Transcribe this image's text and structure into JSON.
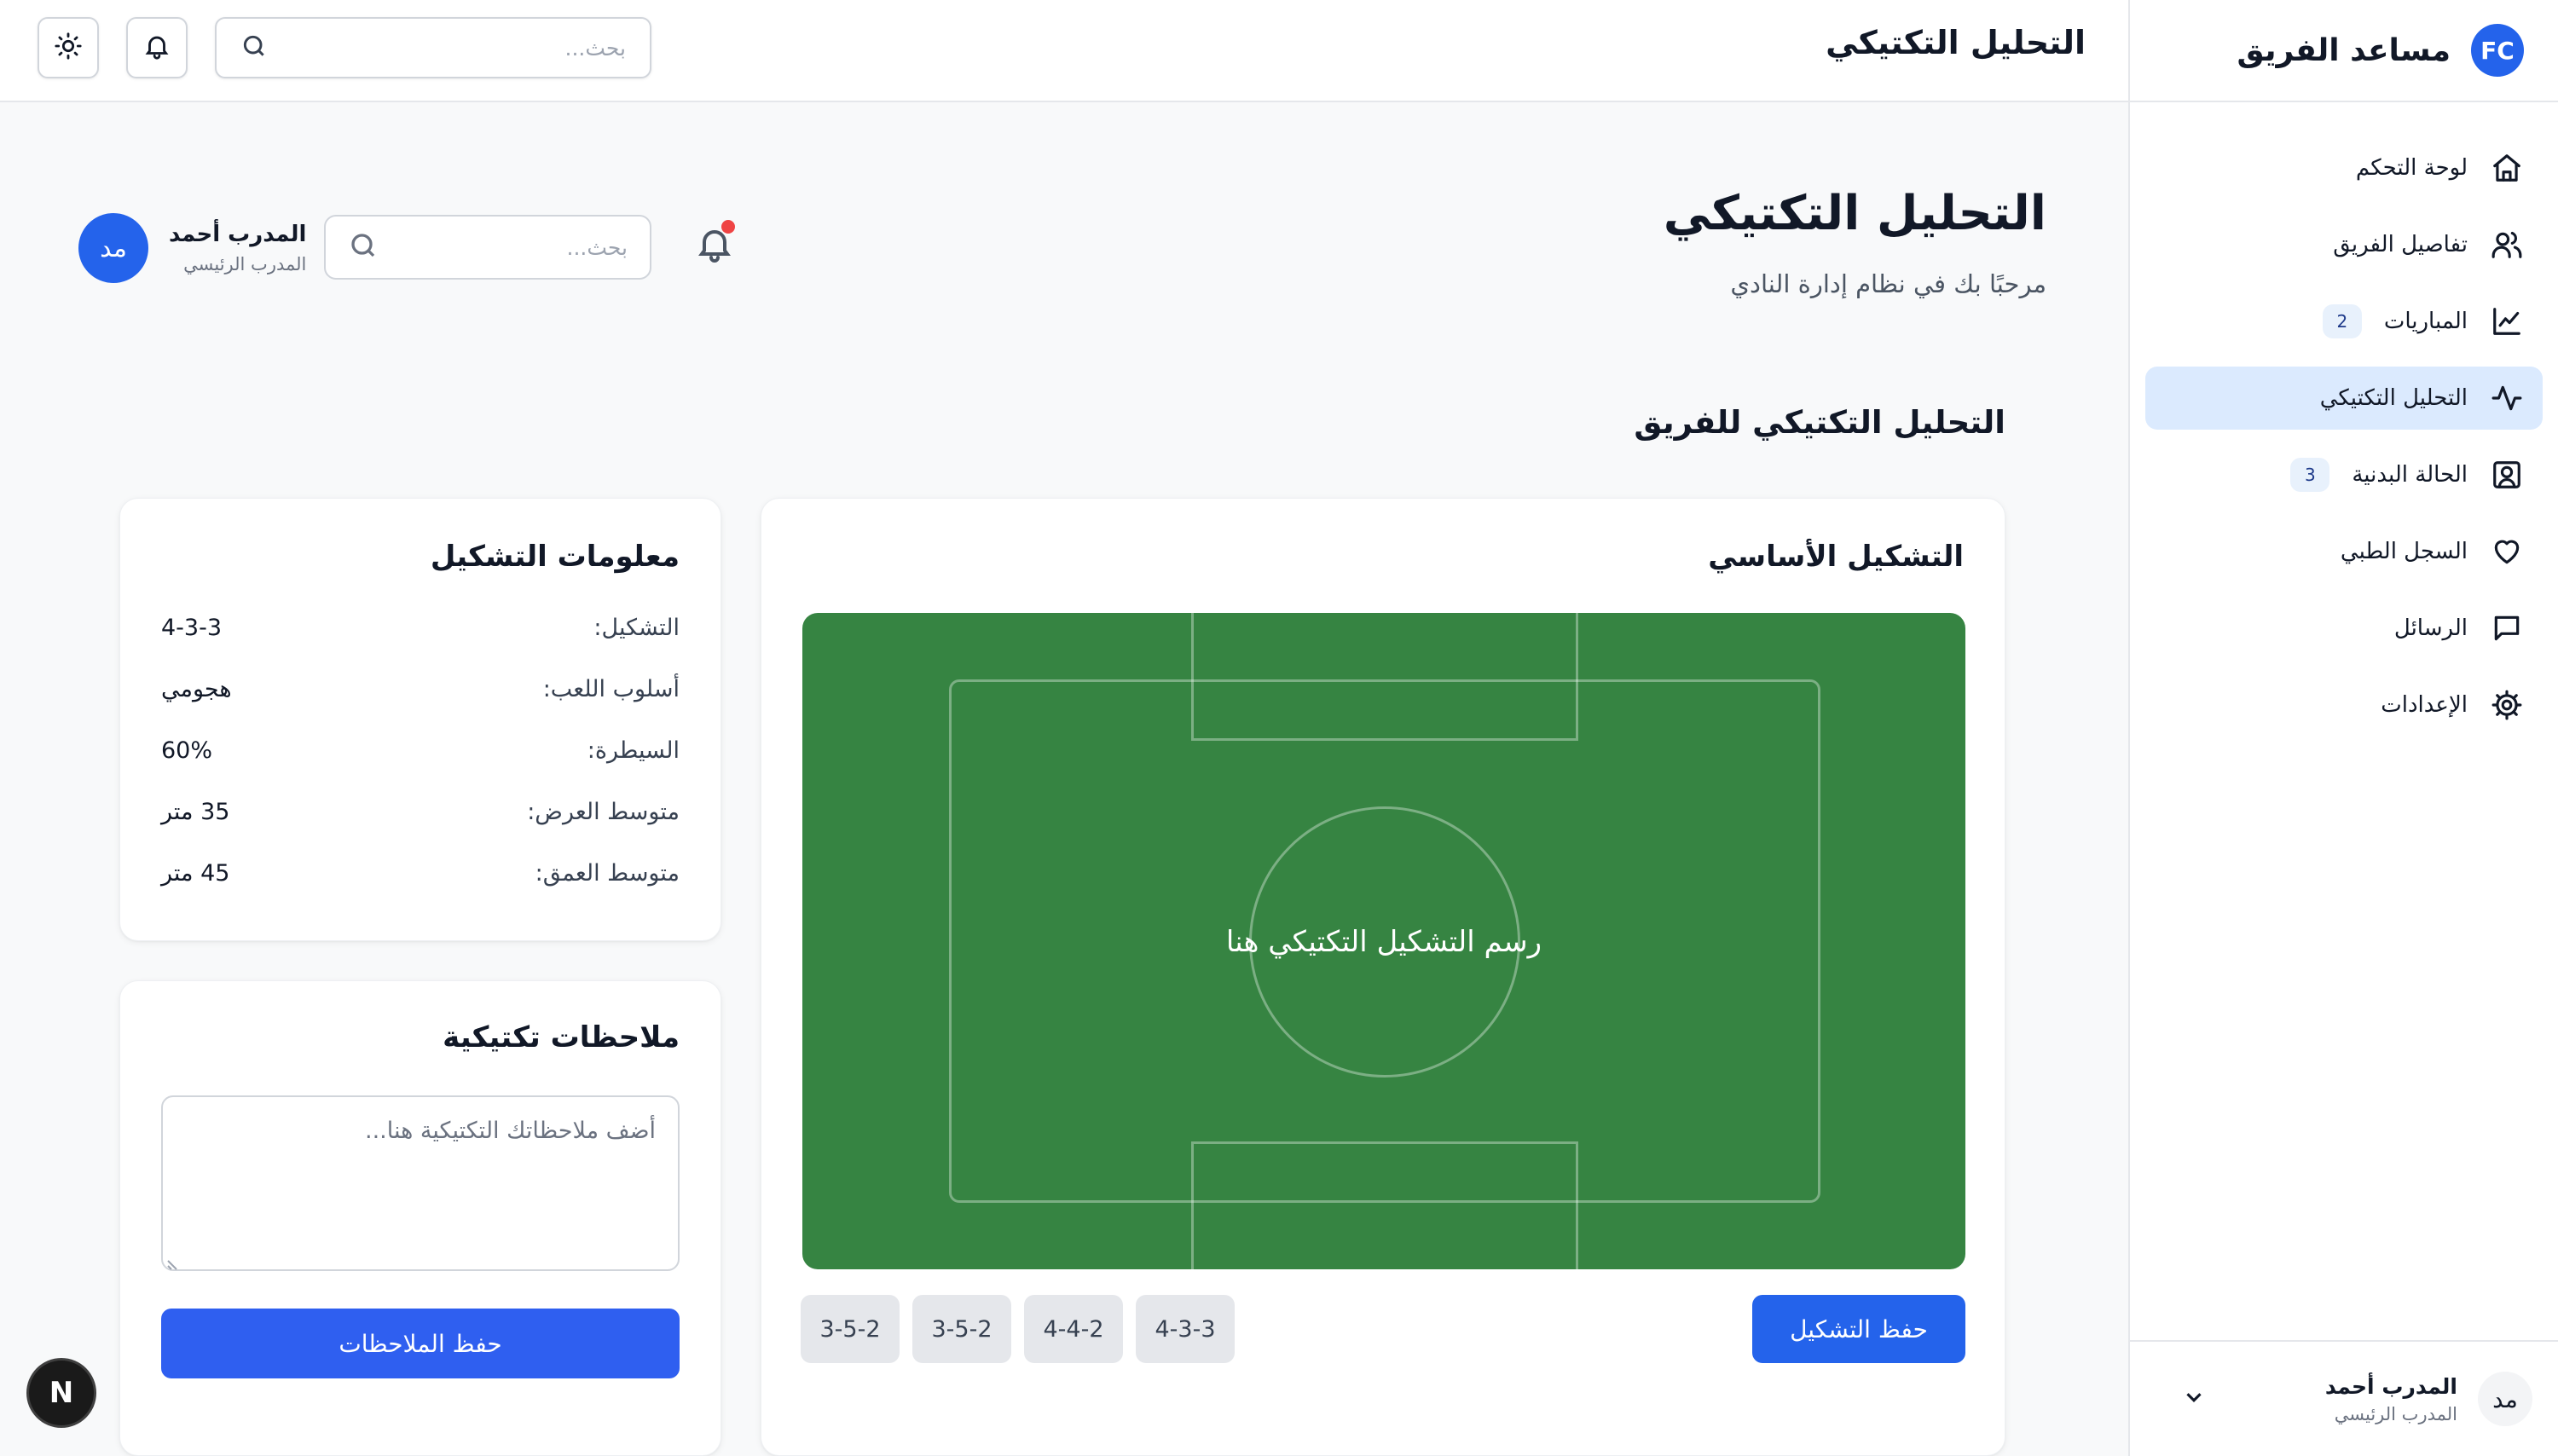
{
  "app": {
    "logo_text": "FC",
    "title": "مساعد الفريق"
  },
  "sidebar": {
    "items": [
      {
        "label": "لوحة التحكم",
        "icon": "home-icon"
      },
      {
        "label": "تفاصيل الفريق",
        "icon": "users-icon"
      },
      {
        "label": "المباريات",
        "icon": "line-chart-icon",
        "badge": "2"
      },
      {
        "label": "التحليل التكتيكي",
        "icon": "activity-icon",
        "active": true
      },
      {
        "label": "الحالة البدنية",
        "icon": "user-square-icon",
        "badge": "3"
      },
      {
        "label": "السجل الطبي",
        "icon": "heart-icon"
      },
      {
        "label": "الرسائل",
        "icon": "message-icon"
      },
      {
        "label": "الإعدادات",
        "icon": "gear-icon"
      }
    ],
    "footer": {
      "avatar": "مد",
      "name": "المدرب أحمد",
      "role": "المدرب الرئيسي"
    }
  },
  "topbar": {
    "title": "التحليل التكتيكي",
    "search_placeholder": "بحث..."
  },
  "header": {
    "title": "التحليل التكتيكي",
    "subtitle": "مرحبًا بك في نظام إدارة النادي",
    "search_placeholder": "بحث...",
    "user": {
      "avatar": "مد",
      "name": "المدرب أحمد",
      "role": "المدرب الرئيسي"
    }
  },
  "section_title": "التحليل التكتيكي للفريق",
  "formation_card": {
    "title": "التشكيل الأساسي",
    "pitch_label": "رسم التشكيل التكتيكي هنا",
    "save_label": "حفظ التشكيل",
    "presets": [
      "4-3-3",
      "4-4-2",
      "3-5-2",
      "3-5-2"
    ],
    "pitch_color": "#368442"
  },
  "info_card": {
    "title": "معلومات التشكيل",
    "rows": [
      {
        "label": "التشكيل:",
        "value": "4-3-3"
      },
      {
        "label": "أسلوب اللعب:",
        "value": "هجومي"
      },
      {
        "label": "السيطرة:",
        "value": "60%"
      },
      {
        "label": "متوسط العرض:",
        "value": "35 متر"
      },
      {
        "label": "متوسط العمق:",
        "value": "45 متر"
      }
    ]
  },
  "notes_card": {
    "title": "ملاحظات تكتيكية",
    "placeholder": "أضف ملاحظاتك التكتيكية هنا...",
    "save_label": "حفظ الملاحظات"
  },
  "floating_badge": "N",
  "colors": {
    "accent": "#2463eb",
    "active_nav": "#dbeafe",
    "notification": "#ef4444"
  }
}
